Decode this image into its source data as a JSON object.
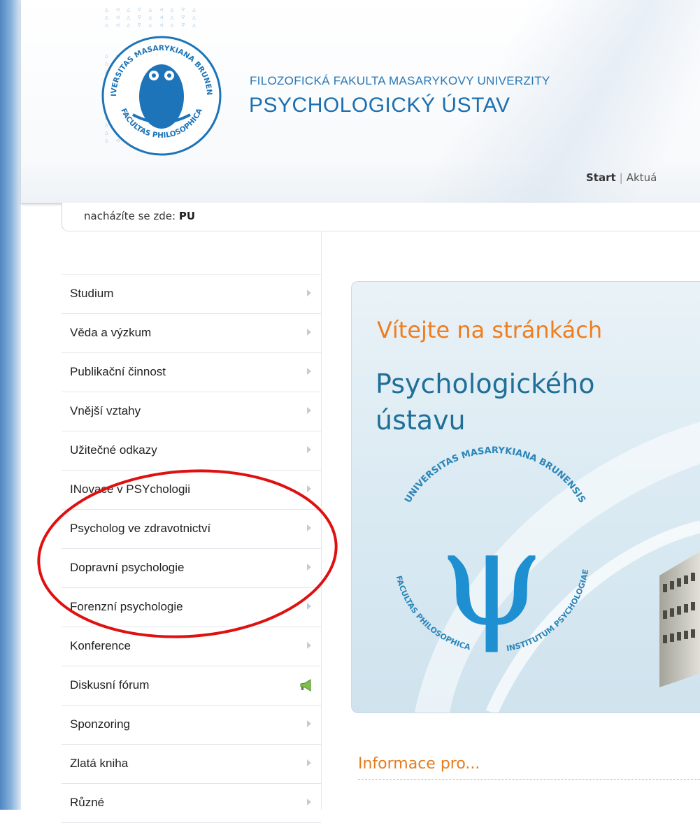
{
  "header": {
    "faculty": "FILOZOFICKÁ FAKULTA MASARYKOVY UNIVERZITY",
    "institute": "PSYCHOLOGICKÝ ÚSTAV",
    "logo": {
      "top_text": "UNIVERSITAS MASARYKIANA BRUNENSIS",
      "bottom_text": "FACULTAS PHILOSOPHICA"
    },
    "nav": {
      "start": "Start",
      "separator": "|",
      "next": "Aktuá"
    }
  },
  "breadcrumb": {
    "prefix": "nacházíte se zde:",
    "current": "PU"
  },
  "sidebar": {
    "items": [
      {
        "label": "Studium",
        "icon": "chevron-right-icon"
      },
      {
        "label": "Věda a výzkum",
        "icon": "chevron-right-icon"
      },
      {
        "label": "Publikační činnost",
        "icon": "chevron-right-icon"
      },
      {
        "label": "Vnější vztahy",
        "icon": "chevron-right-icon"
      },
      {
        "label": "Užitečné odkazy",
        "icon": "chevron-right-icon"
      },
      {
        "label": "INovace v PSYchologii",
        "icon": "chevron-right-icon"
      },
      {
        "label": "Psycholog ve zdravotnictví",
        "icon": "chevron-right-icon"
      },
      {
        "label": "Dopravní psychologie",
        "icon": "chevron-right-icon"
      },
      {
        "label": "Forenzní psychologie",
        "icon": "chevron-right-icon"
      },
      {
        "label": "Konference",
        "icon": "chevron-right-icon"
      },
      {
        "label": "Diskusní fórum",
        "icon": "megaphone-icon"
      },
      {
        "label": "Sponzoring",
        "icon": "chevron-right-icon"
      },
      {
        "label": "Zlatá kniha",
        "icon": "chevron-right-icon"
      },
      {
        "label": "Různé",
        "icon": "chevron-right-icon"
      }
    ]
  },
  "banner": {
    "welcome": "Vítejte na stránkách",
    "title_line1": "Psychologického",
    "title_line2": "ústavu",
    "seal": {
      "top_text": "UNIVERSITAS MASARYKIANA BRUNENSIS",
      "left_text": "FACULTAS PHILOSOPHICA",
      "bottom_text": "INSTITUTUM PSYCHOLOGIAE",
      "symbol": "ψ"
    }
  },
  "info": {
    "heading": "Informace pro..."
  },
  "colors": {
    "brand_blue": "#1c6fb0",
    "accent_orange": "#f07d1e",
    "annotation_red": "#e01010"
  }
}
